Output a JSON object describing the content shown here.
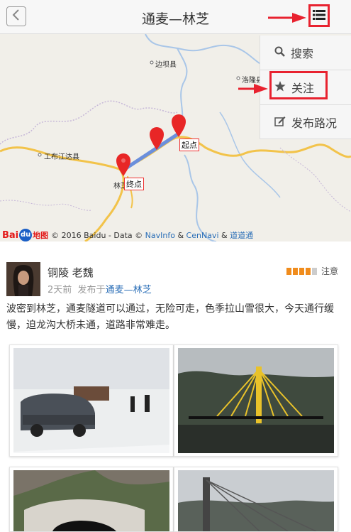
{
  "header": {
    "title": "通麦—林芝"
  },
  "menu": {
    "items": [
      {
        "label": "搜索",
        "icon": "search-icon"
      },
      {
        "label": "关注",
        "icon": "star-icon"
      },
      {
        "label": "发布路况",
        "icon": "edit-icon"
      }
    ]
  },
  "map": {
    "place_labels": [
      "边坝县",
      "洛隆县",
      "工布江达县",
      "林芝"
    ],
    "start_marker": "起点",
    "end_marker": "终点",
    "copyright": {
      "logo_text": "Bai",
      "logo_paw": "du",
      "logo_suffix": "地图",
      "prefix": "© 2016 Baidu - Data ©",
      "navinfo": "NavInfo",
      "amp1": "&",
      "cennavi": "CenNavi",
      "amp2": "&",
      "daodaotong": "道道通"
    }
  },
  "post": {
    "author": "铜陵 老魏",
    "time": "2天前",
    "published_in_label": "发布于",
    "route_link": "通麦—林芝",
    "level_label": "注意",
    "level_value": 4,
    "level_max": 5,
    "content": "波密到林芝，通麦隧道可以通过，无险可走，色季拉山雪很大，今天通行缓慢，迫龙沟大桥未通，道路非常难走。"
  },
  "colors": {
    "accent_red": "#e8222f",
    "link_blue": "#2a6eb7",
    "level_orange": "#f08c1c"
  }
}
